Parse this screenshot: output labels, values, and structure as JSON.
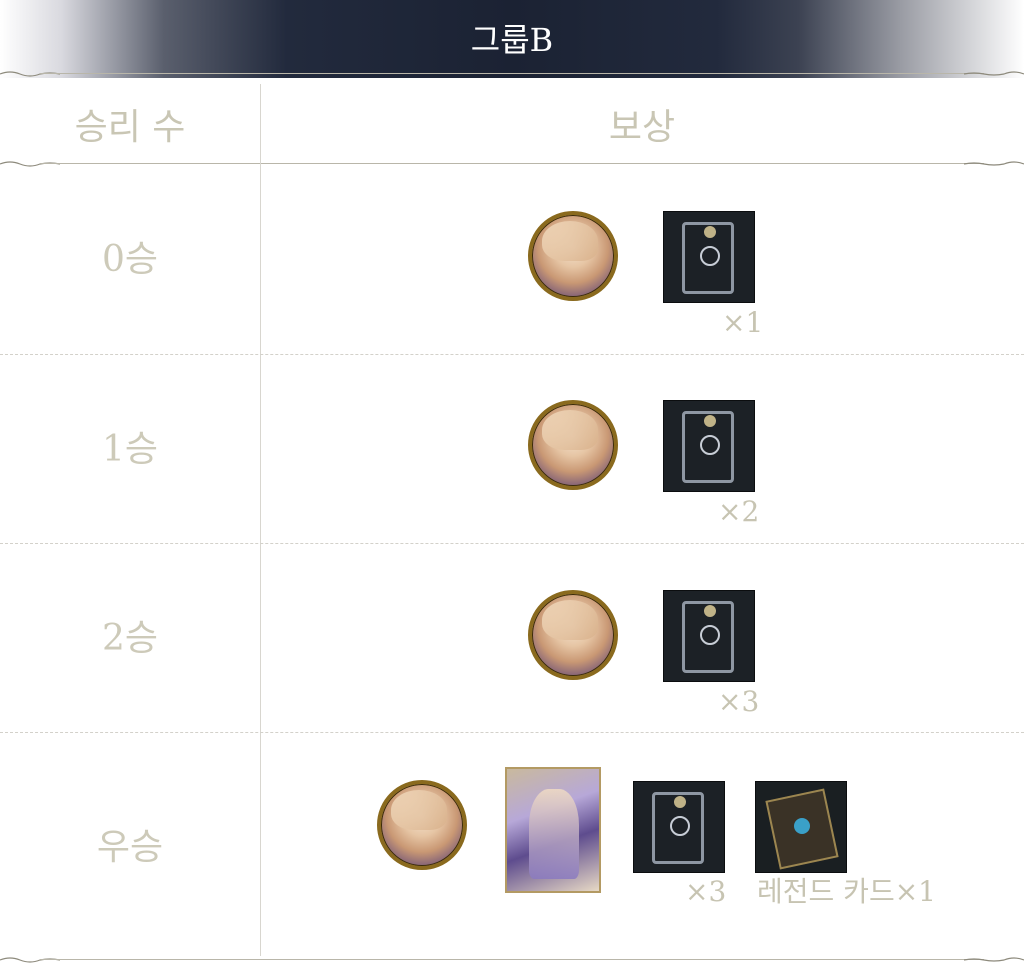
{
  "banner": {
    "title": "그룹B"
  },
  "table": {
    "header_wins": "승리 수",
    "header_reward": "보상",
    "rows": [
      {
        "wins": "0승",
        "qty": "×1"
      },
      {
        "wins": "1승",
        "qty": "×2"
      },
      {
        "wins": "2승",
        "qty": "×3"
      },
      {
        "wins": "우승",
        "qty": "×3",
        "extra": "레전드 카드×1"
      }
    ]
  },
  "icons": {
    "portrait": "character-portrait-icon",
    "card_back": "card-pack-icon",
    "character_card": "character-card-icon",
    "legend_card": "legend-card-icon"
  }
}
